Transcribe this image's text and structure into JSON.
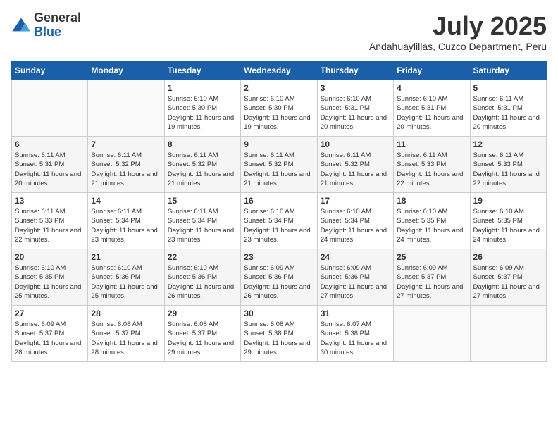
{
  "logo": {
    "general": "General",
    "blue": "Blue"
  },
  "title": {
    "month": "July 2025",
    "location": "Andahuaylillas, Cuzco Department, Peru"
  },
  "days_of_week": [
    "Sunday",
    "Monday",
    "Tuesday",
    "Wednesday",
    "Thursday",
    "Friday",
    "Saturday"
  ],
  "weeks": [
    [
      {
        "day": "",
        "info": ""
      },
      {
        "day": "",
        "info": ""
      },
      {
        "day": "1",
        "info": "Sunrise: 6:10 AM\nSunset: 5:30 PM\nDaylight: 11 hours and 19 minutes."
      },
      {
        "day": "2",
        "info": "Sunrise: 6:10 AM\nSunset: 5:30 PM\nDaylight: 11 hours and 19 minutes."
      },
      {
        "day": "3",
        "info": "Sunrise: 6:10 AM\nSunset: 5:31 PM\nDaylight: 11 hours and 20 minutes."
      },
      {
        "day": "4",
        "info": "Sunrise: 6:10 AM\nSunset: 5:31 PM\nDaylight: 11 hours and 20 minutes."
      },
      {
        "day": "5",
        "info": "Sunrise: 6:11 AM\nSunset: 5:31 PM\nDaylight: 11 hours and 20 minutes."
      }
    ],
    [
      {
        "day": "6",
        "info": "Sunrise: 6:11 AM\nSunset: 5:31 PM\nDaylight: 11 hours and 20 minutes."
      },
      {
        "day": "7",
        "info": "Sunrise: 6:11 AM\nSunset: 5:32 PM\nDaylight: 11 hours and 21 minutes."
      },
      {
        "day": "8",
        "info": "Sunrise: 6:11 AM\nSunset: 5:32 PM\nDaylight: 11 hours and 21 minutes."
      },
      {
        "day": "9",
        "info": "Sunrise: 6:11 AM\nSunset: 5:32 PM\nDaylight: 11 hours and 21 minutes."
      },
      {
        "day": "10",
        "info": "Sunrise: 6:11 AM\nSunset: 5:32 PM\nDaylight: 11 hours and 21 minutes."
      },
      {
        "day": "11",
        "info": "Sunrise: 6:11 AM\nSunset: 5:33 PM\nDaylight: 11 hours and 22 minutes."
      },
      {
        "day": "12",
        "info": "Sunrise: 6:11 AM\nSunset: 5:33 PM\nDaylight: 11 hours and 22 minutes."
      }
    ],
    [
      {
        "day": "13",
        "info": "Sunrise: 6:11 AM\nSunset: 5:33 PM\nDaylight: 11 hours and 22 minutes."
      },
      {
        "day": "14",
        "info": "Sunrise: 6:11 AM\nSunset: 5:34 PM\nDaylight: 11 hours and 23 minutes."
      },
      {
        "day": "15",
        "info": "Sunrise: 6:11 AM\nSunset: 5:34 PM\nDaylight: 11 hours and 23 minutes."
      },
      {
        "day": "16",
        "info": "Sunrise: 6:10 AM\nSunset: 5:34 PM\nDaylight: 11 hours and 23 minutes."
      },
      {
        "day": "17",
        "info": "Sunrise: 6:10 AM\nSunset: 5:34 PM\nDaylight: 11 hours and 24 minutes."
      },
      {
        "day": "18",
        "info": "Sunrise: 6:10 AM\nSunset: 5:35 PM\nDaylight: 11 hours and 24 minutes."
      },
      {
        "day": "19",
        "info": "Sunrise: 6:10 AM\nSunset: 5:35 PM\nDaylight: 11 hours and 24 minutes."
      }
    ],
    [
      {
        "day": "20",
        "info": "Sunrise: 6:10 AM\nSunset: 5:35 PM\nDaylight: 11 hours and 25 minutes."
      },
      {
        "day": "21",
        "info": "Sunrise: 6:10 AM\nSunset: 5:36 PM\nDaylight: 11 hours and 25 minutes."
      },
      {
        "day": "22",
        "info": "Sunrise: 6:10 AM\nSunset: 5:36 PM\nDaylight: 11 hours and 26 minutes."
      },
      {
        "day": "23",
        "info": "Sunrise: 6:09 AM\nSunset: 5:36 PM\nDaylight: 11 hours and 26 minutes."
      },
      {
        "day": "24",
        "info": "Sunrise: 6:09 AM\nSunset: 5:36 PM\nDaylight: 11 hours and 27 minutes."
      },
      {
        "day": "25",
        "info": "Sunrise: 6:09 AM\nSunset: 5:37 PM\nDaylight: 11 hours and 27 minutes."
      },
      {
        "day": "26",
        "info": "Sunrise: 6:09 AM\nSunset: 5:37 PM\nDaylight: 11 hours and 27 minutes."
      }
    ],
    [
      {
        "day": "27",
        "info": "Sunrise: 6:09 AM\nSunset: 5:37 PM\nDaylight: 11 hours and 28 minutes."
      },
      {
        "day": "28",
        "info": "Sunrise: 6:08 AM\nSunset: 5:37 PM\nDaylight: 11 hours and 28 minutes."
      },
      {
        "day": "29",
        "info": "Sunrise: 6:08 AM\nSunset: 5:37 PM\nDaylight: 11 hours and 29 minutes."
      },
      {
        "day": "30",
        "info": "Sunrise: 6:08 AM\nSunset: 5:38 PM\nDaylight: 11 hours and 29 minutes."
      },
      {
        "day": "31",
        "info": "Sunrise: 6:07 AM\nSunset: 5:38 PM\nDaylight: 11 hours and 30 minutes."
      },
      {
        "day": "",
        "info": ""
      },
      {
        "day": "",
        "info": ""
      }
    ]
  ]
}
